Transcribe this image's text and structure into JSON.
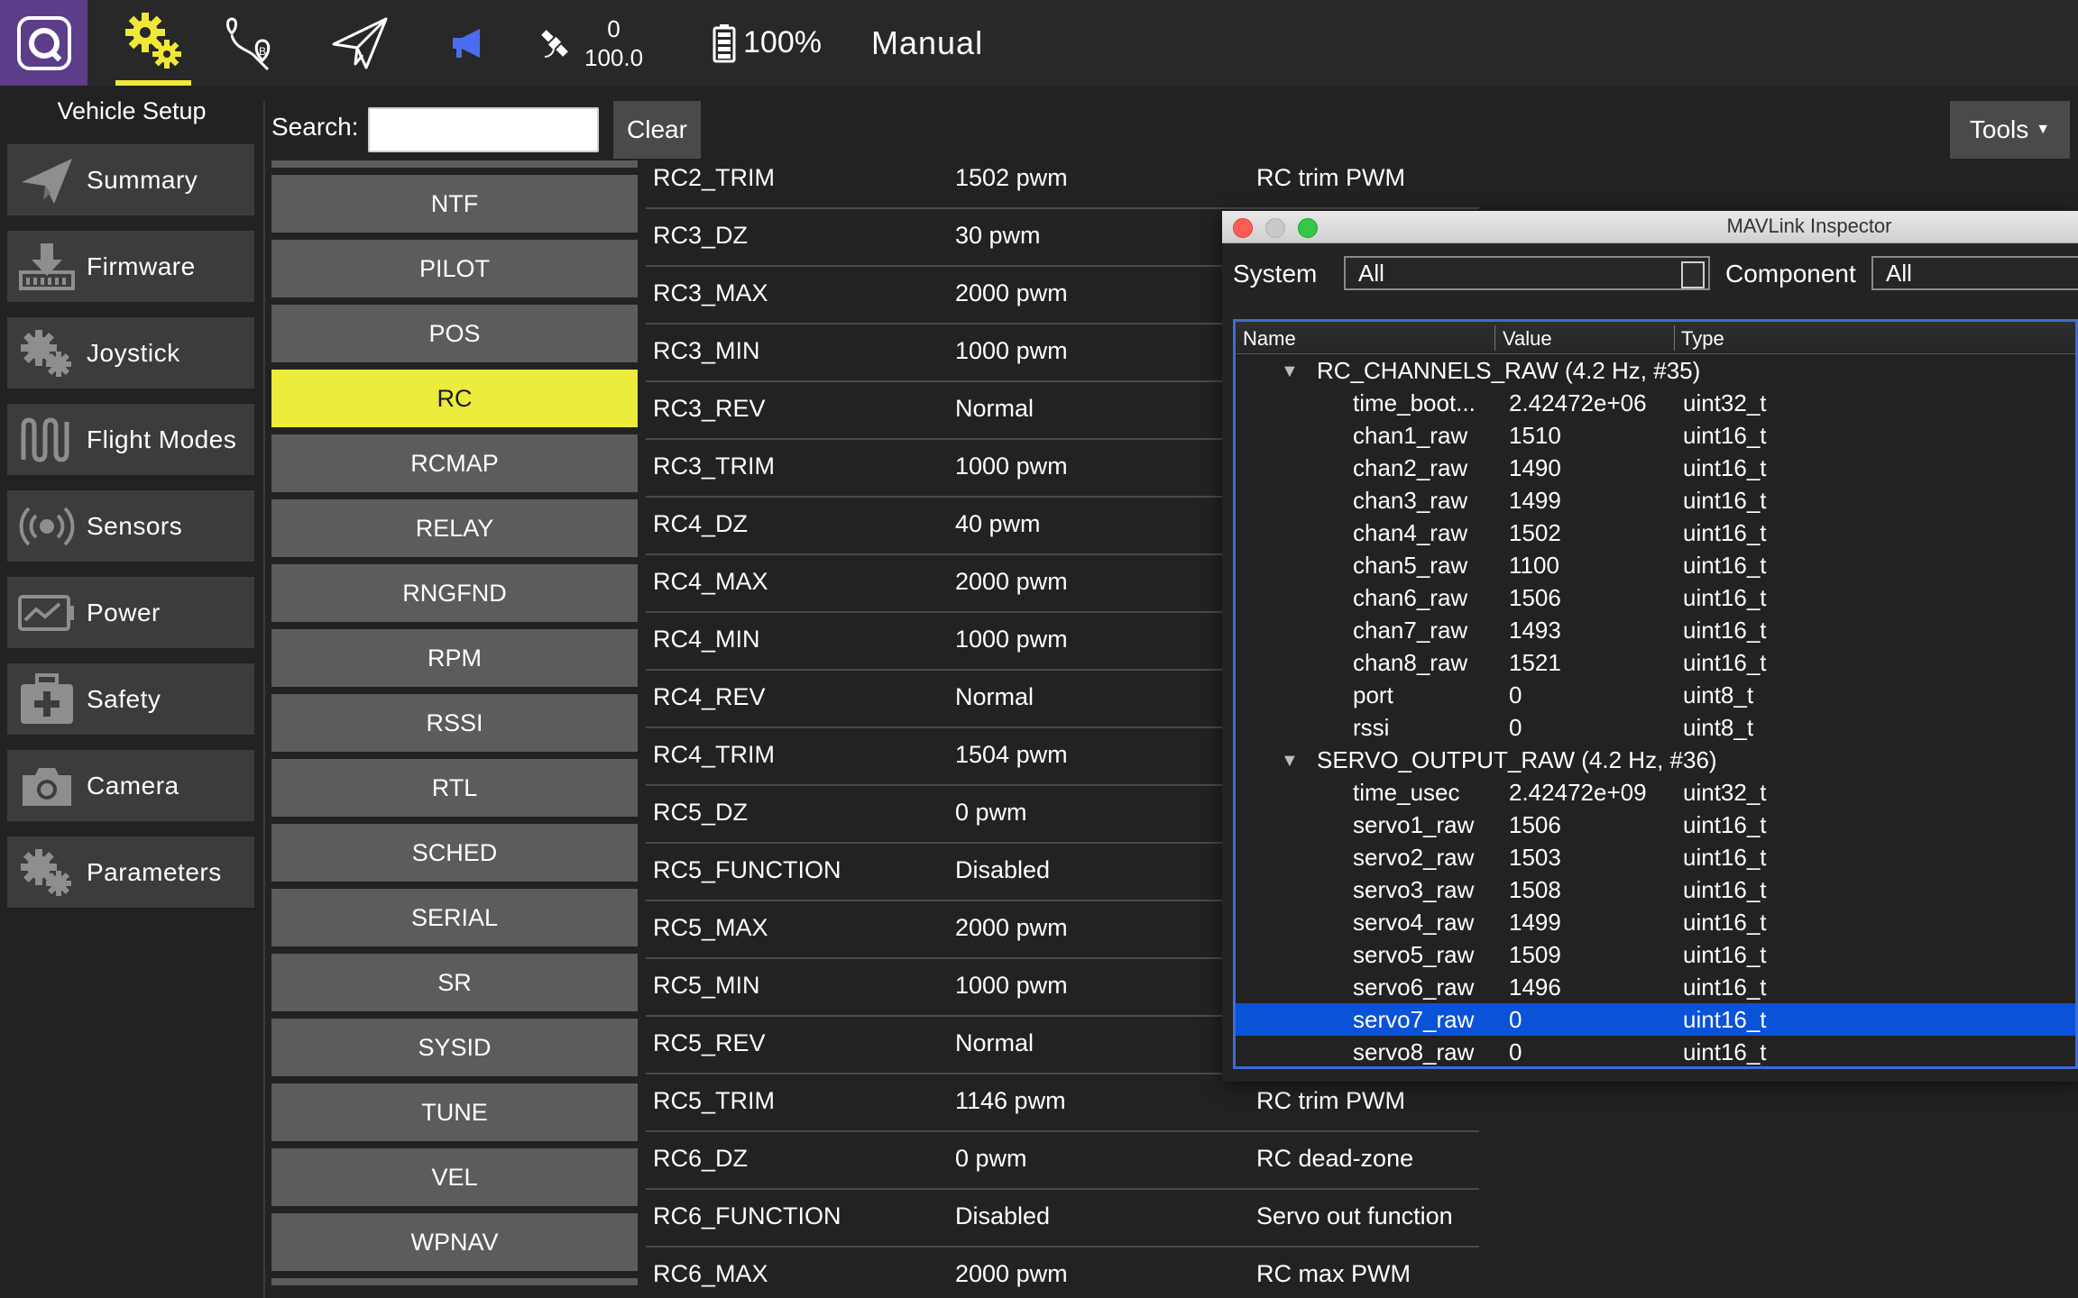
{
  "toolbar": {
    "gps_count": "0",
    "gps_hdop": "100.0",
    "battery": "100%",
    "flight_mode": "Manual"
  },
  "sidebar": {
    "title": "Vehicle Setup",
    "items": [
      {
        "label": "Summary",
        "icon": "paper-plane-icon"
      },
      {
        "label": "Firmware",
        "icon": "download-icon"
      },
      {
        "label": "Joystick",
        "icon": "gears-icon"
      },
      {
        "label": "Flight Modes",
        "icon": "wave-icon"
      },
      {
        "label": "Sensors",
        "icon": "radio-waves-icon"
      },
      {
        "label": "Power",
        "icon": "battery-chart-icon"
      },
      {
        "label": "Safety",
        "icon": "first-aid-kit-icon"
      },
      {
        "label": "Camera",
        "icon": "camera-icon"
      },
      {
        "label": "Parameters",
        "icon": "gears-icon"
      }
    ]
  },
  "search": {
    "label": "Search:",
    "value": "",
    "clear_label": "Clear"
  },
  "tools": {
    "label": "Tools"
  },
  "groups": {
    "items": [
      "NTF",
      "PILOT",
      "POS",
      "RC",
      "RCMAP",
      "RELAY",
      "RNGFND",
      "RPM",
      "RSSI",
      "RTL",
      "SCHED",
      "SERIAL",
      "SR",
      "SYSID",
      "TUNE",
      "VEL",
      "WPNAV"
    ],
    "selected": "RC"
  },
  "params": [
    {
      "name": "RC2_TRIM",
      "value": "1502 pwm",
      "desc": "RC trim PWM"
    },
    {
      "name": "RC3_DZ",
      "value": "30 pwm",
      "desc": ""
    },
    {
      "name": "RC3_MAX",
      "value": "2000 pwm",
      "desc": ""
    },
    {
      "name": "RC3_MIN",
      "value": "1000 pwm",
      "desc": ""
    },
    {
      "name": "RC3_REV",
      "value": "Normal",
      "desc": ""
    },
    {
      "name": "RC3_TRIM",
      "value": "1000 pwm",
      "desc": ""
    },
    {
      "name": "RC4_DZ",
      "value": "40 pwm",
      "desc": ""
    },
    {
      "name": "RC4_MAX",
      "value": "2000 pwm",
      "desc": ""
    },
    {
      "name": "RC4_MIN",
      "value": "1000 pwm",
      "desc": ""
    },
    {
      "name": "RC4_REV",
      "value": "Normal",
      "desc": ""
    },
    {
      "name": "RC4_TRIM",
      "value": "1504 pwm",
      "desc": ""
    },
    {
      "name": "RC5_DZ",
      "value": "0 pwm",
      "desc": ""
    },
    {
      "name": "RC5_FUNCTION",
      "value": "Disabled",
      "desc": ""
    },
    {
      "name": "RC5_MAX",
      "value": "2000 pwm",
      "desc": ""
    },
    {
      "name": "RC5_MIN",
      "value": "1000 pwm",
      "desc": ""
    },
    {
      "name": "RC5_REV",
      "value": "Normal",
      "desc": ""
    },
    {
      "name": "RC5_TRIM",
      "value": "1146 pwm",
      "desc": "RC trim PWM"
    },
    {
      "name": "RC6_DZ",
      "value": "0 pwm",
      "desc": "RC dead-zone"
    },
    {
      "name": "RC6_FUNCTION",
      "value": "Disabled",
      "desc": "Servo out function"
    },
    {
      "name": "RC6_MAX",
      "value": "2000 pwm",
      "desc": "RC max PWM"
    }
  ],
  "inspector": {
    "title": "MAVLink Inspector",
    "system_label": "System",
    "system_value": "All",
    "component_label": "Component",
    "component_value": "All",
    "columns": [
      "Name",
      "Value",
      "Type"
    ],
    "rows": [
      {
        "kind": "group",
        "label": "RC_CHANNELS_RAW (4.2 Hz, #35)"
      },
      {
        "kind": "field",
        "name": "time_boot...",
        "value": "2.42472e+06",
        "type": "uint32_t"
      },
      {
        "kind": "field",
        "name": "chan1_raw",
        "value": "1510",
        "type": "uint16_t"
      },
      {
        "kind": "field",
        "name": "chan2_raw",
        "value": "1490",
        "type": "uint16_t"
      },
      {
        "kind": "field",
        "name": "chan3_raw",
        "value": "1499",
        "type": "uint16_t"
      },
      {
        "kind": "field",
        "name": "chan4_raw",
        "value": "1502",
        "type": "uint16_t"
      },
      {
        "kind": "field",
        "name": "chan5_raw",
        "value": "1100",
        "type": "uint16_t"
      },
      {
        "kind": "field",
        "name": "chan6_raw",
        "value": "1506",
        "type": "uint16_t"
      },
      {
        "kind": "field",
        "name": "chan7_raw",
        "value": "1493",
        "type": "uint16_t"
      },
      {
        "kind": "field",
        "name": "chan8_raw",
        "value": "1521",
        "type": "uint16_t"
      },
      {
        "kind": "field",
        "name": "port",
        "value": "0",
        "type": "uint8_t"
      },
      {
        "kind": "field",
        "name": "rssi",
        "value": "0",
        "type": "uint8_t"
      },
      {
        "kind": "group",
        "label": "SERVO_OUTPUT_RAW (4.2 Hz, #36)"
      },
      {
        "kind": "field",
        "name": "time_usec",
        "value": "2.42472e+09",
        "type": "uint32_t"
      },
      {
        "kind": "field",
        "name": "servo1_raw",
        "value": "1506",
        "type": "uint16_t"
      },
      {
        "kind": "field",
        "name": "servo2_raw",
        "value": "1503",
        "type": "uint16_t"
      },
      {
        "kind": "field",
        "name": "servo3_raw",
        "value": "1508",
        "type": "uint16_t"
      },
      {
        "kind": "field",
        "name": "servo4_raw",
        "value": "1499",
        "type": "uint16_t"
      },
      {
        "kind": "field",
        "name": "servo5_raw",
        "value": "1509",
        "type": "uint16_t"
      },
      {
        "kind": "field",
        "name": "servo6_raw",
        "value": "1496",
        "type": "uint16_t"
      },
      {
        "kind": "field",
        "name": "servo7_raw",
        "value": "0",
        "type": "uint16_t",
        "selected": true
      },
      {
        "kind": "field",
        "name": "servo8_raw",
        "value": "0",
        "type": "uint16_t"
      }
    ]
  },
  "colors": {
    "accent_yellow": "#ecec3c",
    "logo_purple": "#5c3d8a",
    "selection_blue": "#0a52d8",
    "announce_blue": "#4a6cf0"
  }
}
